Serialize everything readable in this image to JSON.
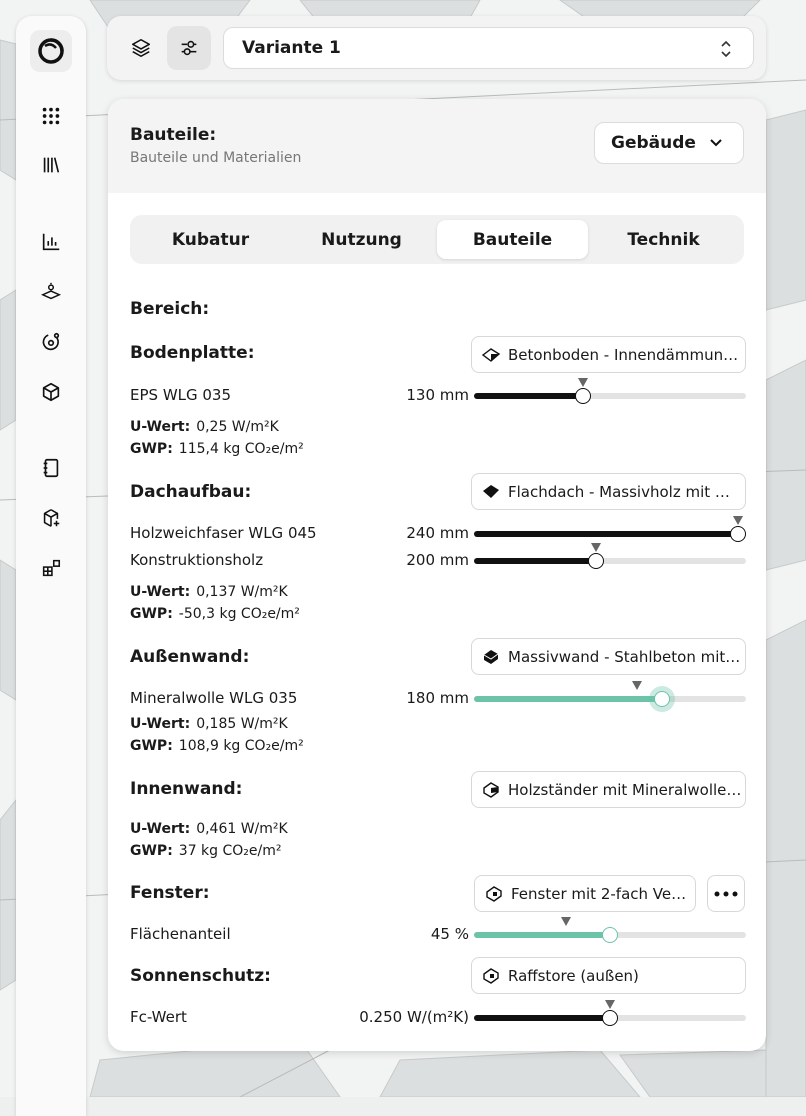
{
  "topbar": {
    "layers_icon": "layers-icon",
    "settings_icon": "sliders-icon",
    "variant_value": "Variante 1"
  },
  "sidebar": {
    "items": [
      {
        "icon": "logo-icon"
      },
      {
        "icon": "apps-grid-icon"
      },
      {
        "icon": "library-icon"
      },
      {
        "icon": "bar-chart-icon"
      },
      {
        "icon": "sun-plane-icon"
      },
      {
        "icon": "cycle-icon"
      },
      {
        "icon": "cube-icon"
      },
      {
        "icon": "notebook-icon"
      },
      {
        "icon": "package-add-icon"
      },
      {
        "icon": "blocks-icon"
      }
    ]
  },
  "panel": {
    "title": "Bauteile:",
    "subtitle": "Bauteile und Materialien",
    "building_select": "Gebäude",
    "tabs": [
      {
        "label": "Kubatur",
        "active": false
      },
      {
        "label": "Nutzung",
        "active": false
      },
      {
        "label": "Bauteile",
        "active": true
      },
      {
        "label": "Technik",
        "active": false
      }
    ],
    "bereich_label": "Bereich:"
  },
  "sections": {
    "bodenplatte": {
      "label": "Bodenplatte:",
      "construction": "Betonboden - Innendämmun…",
      "layers": [
        {
          "name": "EPS WLG 035",
          "value": "130 mm",
          "fill": 0.4,
          "marker": 0.4
        }
      ],
      "u_label": "U-Wert:",
      "u_value": "0,25 W/m²K",
      "gwp_label": "GWP:",
      "gwp_value": "115,4 kg CO₂e/m²"
    },
    "dachaufbau": {
      "label": "Dachaufbau:",
      "construction": "Flachdach - Massivholz mit …",
      "layers": [
        {
          "name": "Holzweichfaser WLG 045",
          "value": "240 mm",
          "fill": 0.97,
          "marker": 0.97
        },
        {
          "name": "Konstruktionsholz",
          "value": "200 mm",
          "fill": 0.45,
          "marker": 0.45
        }
      ],
      "u_label": "U-Wert:",
      "u_value": "0,137 W/m²K",
      "gwp_label": "GWP:",
      "gwp_value": "-50,3 kg CO₂e/m²"
    },
    "aussenwand": {
      "label": "Außenwand:",
      "construction": "Massivwand - Stahlbeton mit…",
      "layers": [
        {
          "name": "Mineralwolle WLG 035",
          "value": "180 mm",
          "fill": 0.69,
          "marker": 0.6
        }
      ],
      "u_label": "U-Wert:",
      "u_value": "0,185 W/m²K",
      "gwp_label": "GWP:",
      "gwp_value": "108,9 kg CO₂e/m²"
    },
    "innenwand": {
      "label": "Innenwand:",
      "construction": "Holzständer mit Mineralwolle…",
      "u_label": "U-Wert:",
      "u_value": "0,461 W/m²K",
      "gwp_label": "GWP:",
      "gwp_value": "37 kg CO₂e/m²"
    },
    "fenster": {
      "label": "Fenster:",
      "construction": "Fenster mit 2-fach Ve…",
      "more_icon": "more-dots-icon",
      "layers": [
        {
          "name": "Flächenanteil",
          "value": "45 %",
          "fill": 0.5,
          "marker": 0.34
        }
      ]
    },
    "sonnenschutz": {
      "label": "Sonnenschutz:",
      "construction": "Raffstore (außen)",
      "layers": [
        {
          "name": "Fc-Wert",
          "value": "0.250 W/(m²K)",
          "fill": 0.5,
          "marker": 0.5
        }
      ]
    }
  },
  "colors": {
    "accent": "#6cc3a8",
    "dark": "#111111",
    "track": "#e3e3e3"
  }
}
